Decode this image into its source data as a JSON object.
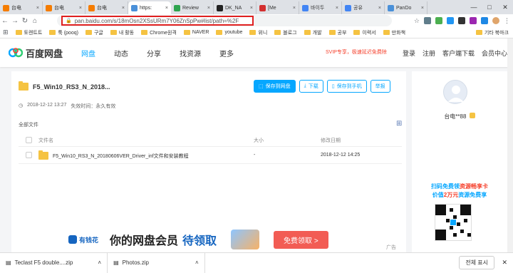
{
  "browser": {
    "tabs": [
      {
        "label": "台电",
        "color": "#f57c00"
      },
      {
        "label": "台电",
        "color": "#f57c00"
      },
      {
        "label": "台电",
        "color": "#f57c00"
      },
      {
        "label": "https:",
        "color": "#4a90d9"
      },
      {
        "label": "Review",
        "color": "#2ea44f"
      },
      {
        "label": "DK_NA",
        "color": "#222"
      },
      {
        "label": "[Me",
        "color": "#d32f2f"
      },
      {
        "label": "바이두",
        "color": "#4285f4"
      },
      {
        "label": "공유",
        "color": "#4285f4"
      },
      {
        "label": "PanDo",
        "color": "#4a90d9"
      }
    ],
    "url": "pan.baidu.com/s/18mOsn2XSsURm7Y06ZnSpPw#list/path=%2F",
    "bookmarks": [
      "토렌트트",
      "툭 (pooq)",
      "구글",
      "내 활동",
      "Chrome원격",
      "NAVER",
      "youtube",
      "위니",
      "블로그",
      "개발",
      "공부",
      "이력서",
      "만화책",
      "기타 북마크"
    ],
    "window_controls": [
      "—",
      "□",
      "✕"
    ]
  },
  "header": {
    "logo": "百度网盘",
    "nav": [
      "网盘",
      "动态",
      "分享",
      "找资源",
      "更多"
    ],
    "svip": "SVIP专享，极速延迟免费除",
    "right": [
      "登录",
      "注册",
      "客户端下载",
      "会员中心"
    ]
  },
  "share": {
    "title": "F5_Win10_RS3_N_2018...",
    "buttons": [
      "保存到网盘",
      "下载",
      "保存到手机",
      "举报"
    ],
    "date": "2018-12-12 13:27",
    "expire": "失效时间：永久有效",
    "all_files": "全部文件",
    "columns": [
      "文件名",
      "大小",
      "修改日期"
    ],
    "rows": [
      {
        "name": "F5_Win10_RS3_N_20180606VER_Driver_inf文件和安装教程",
        "size": "-",
        "date": "2018-12-12 14:25"
      }
    ]
  },
  "ad": {
    "brand": "有钱花",
    "text": "你的网盘会员",
    "highlight": "待领取",
    "button": "免费领取 >",
    "tag": "广告"
  },
  "sidebar": {
    "user": "台电**88",
    "promo_line1_a": "扫码免费领",
    "promo_line1_b": "资源畅享卡",
    "promo_line2_a": "价值",
    "promo_line2_b": "2万元",
    "promo_line2_c": "资源免费享"
  },
  "downloads": {
    "items": [
      "Teclast F5 double....zip",
      "Photos.zip"
    ],
    "show_all": "전체 표시"
  }
}
